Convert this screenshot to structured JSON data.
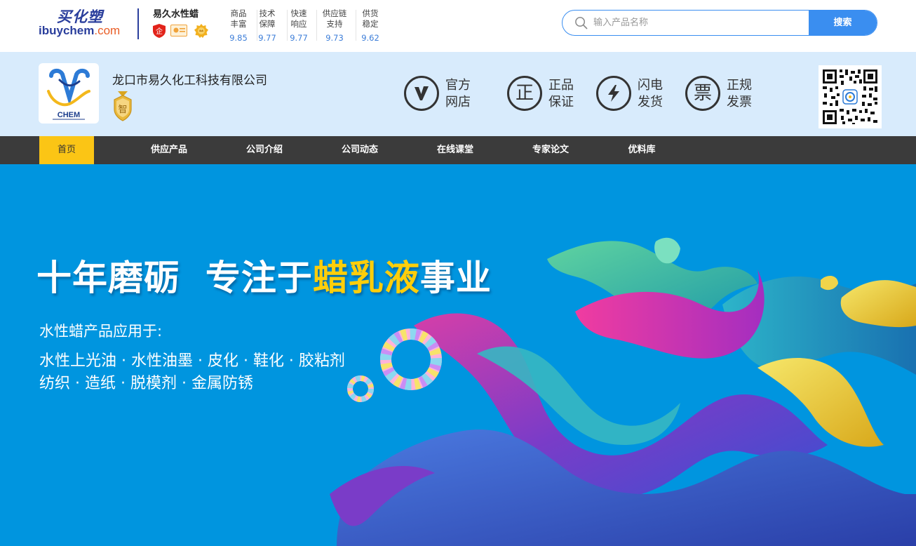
{
  "site": {
    "logo_cn": "买化塑",
    "logo_en_main": "ibuychem",
    "logo_en_suffix": ".com"
  },
  "shop_short": {
    "name": "易久水性蜡",
    "badges": [
      "企",
      "card",
      "crown"
    ]
  },
  "ratings": [
    {
      "label_line1": "商品",
      "label_line2": "丰富",
      "score": "9.85"
    },
    {
      "label_line1": "技术",
      "label_line2": "保障",
      "score": "9.77"
    },
    {
      "label_line1": "快速",
      "label_line2": "响应",
      "score": "9.77"
    },
    {
      "label_line1": "供应链",
      "label_line2": "支持",
      "score": "9.73"
    },
    {
      "label_line1": "供货",
      "label_line2": "稳定",
      "score": "9.62"
    }
  ],
  "search": {
    "placeholder": "输入产品名称",
    "button": "搜索"
  },
  "shop": {
    "company_name": "龙口市易久化工科技有限公司",
    "logo_text": "CHEM",
    "medal_text": "智",
    "features": [
      {
        "icon": "v-icon",
        "line1": "官方",
        "line2": "网店"
      },
      {
        "icon": "zheng-icon",
        "glyph": "正",
        "line1": "正品",
        "line2": "保证"
      },
      {
        "icon": "lightning-icon",
        "line1": "闪电",
        "line2": "发货"
      },
      {
        "icon": "piao-icon",
        "glyph": "票",
        "line1": "正规",
        "line2": "发票"
      }
    ]
  },
  "nav": [
    {
      "label": "首页",
      "active": true
    },
    {
      "label": "供应产品"
    },
    {
      "label": "公司介绍"
    },
    {
      "label": "公司动态"
    },
    {
      "label": "在线课堂"
    },
    {
      "label": "专家论文"
    },
    {
      "label": "优料库"
    }
  ],
  "banner": {
    "slogan_part1": "十年磨砺",
    "slogan_part2": "专注于",
    "slogan_highlight": "蜡乳液",
    "slogan_part3": "事业",
    "apply_heading": "水性蜡产品应用于:",
    "apply_line1": "水性上光油 · 水性油墨 · 皮化 · 鞋化 · 胶粘剂",
    "apply_line2": "纺织 · 造纸 · 脱模剂 · 金属防锈"
  },
  "colors": {
    "brand_blue": "#2a3e9c",
    "accent_orange": "#e95d26",
    "search_blue": "#3a8ef0",
    "score_blue": "#3d7ed8",
    "shopbar_bg": "#d8ebfc",
    "nav_bg": "#3b3b3b",
    "nav_active": "#fbc515",
    "banner_bg": "#0095df",
    "slogan_highlight": "#ffce0a"
  }
}
